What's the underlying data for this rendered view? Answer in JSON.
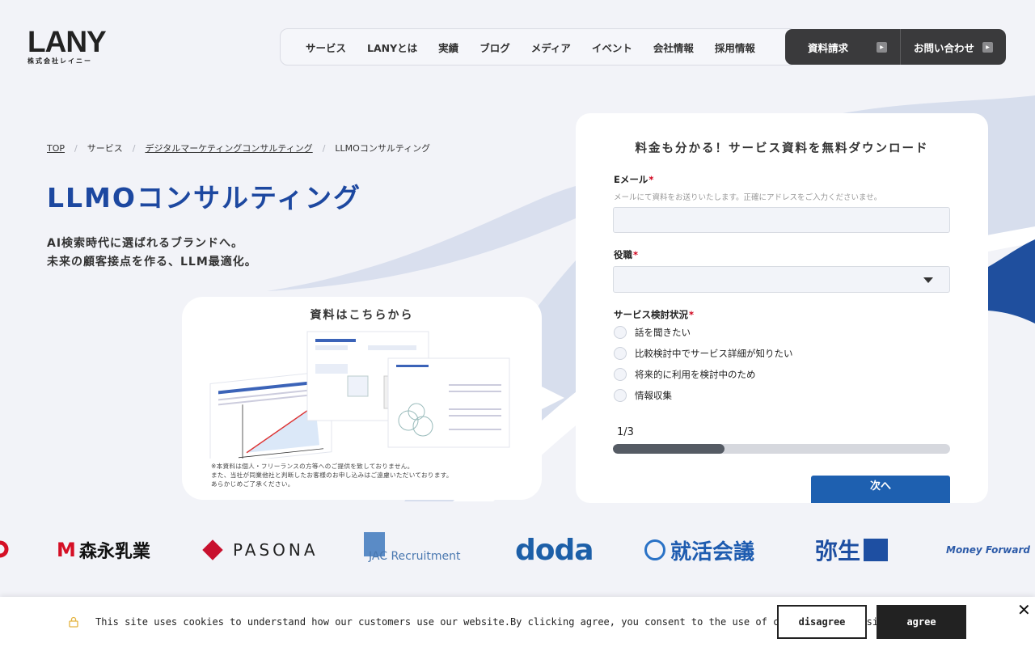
{
  "brand": {
    "name": "LANY",
    "sub": "株式会社レイニー"
  },
  "nav": [
    "サービス",
    "LANYとは",
    "実績",
    "ブログ",
    "メディア",
    "イベント",
    "会社情報",
    "採用情報"
  ],
  "cta": {
    "download": "資料請求",
    "contact": "お問い合わせ",
    "arrow_glyph": "▶"
  },
  "breadcrumb": [
    "TOP",
    "サービス",
    "デジタルマーケティングコンサルティング",
    "LLMOコンサルティング"
  ],
  "breadcrumb_sep": "/",
  "hero": {
    "title": "LLMOコンサルティング",
    "lead1": "AI検索時代に選ばれるブランドへ。",
    "lead2": "未来の顧客接点を作る、LLM最適化。"
  },
  "doc": {
    "title": "資料はこちらから",
    "note1": "※本資料は個人・フリーランスの方等へのご提供を致しておりません。",
    "note2": "また、当社が同業他社と判断したお客様のお申し込みはご遠慮いただいております。",
    "note3": "あらかじめご了承ください。"
  },
  "form": {
    "title": "料金も分かる！サービス資料を無料ダウンロード",
    "email_label": "Eメール",
    "email_hint": "メールにて資料をお送りいたします。正確にアドレスをご入力くださいませ。",
    "email_value": "",
    "role_label": "役職",
    "role_value": "",
    "status_label": "サービス検討状況",
    "required_mark": "*",
    "options": [
      "話を聞きたい",
      "比較検討中でサービス詳細が知りたい",
      "将来的に利用を検討中のため",
      "情報収集"
    ],
    "step": "1/3",
    "progress": 0.33,
    "next_label": "次へ"
  },
  "logos": [
    "森永乳業",
    "PASONA",
    "JAC Recruitment",
    "doda",
    "就活会議",
    "弥生",
    "Money Forward"
  ],
  "cookie": {
    "message": "This site uses cookies to understand how our customers use our website.By clicking agree, you consent to the use of cookies on this site.",
    "disagree": "disagree",
    "agree": "agree",
    "close": "✕"
  },
  "colors": {
    "accent": "#1d48a0",
    "cta_bg": "#3a3a3c",
    "next_bg": "#1e60b0",
    "required": "#d0021b"
  }
}
